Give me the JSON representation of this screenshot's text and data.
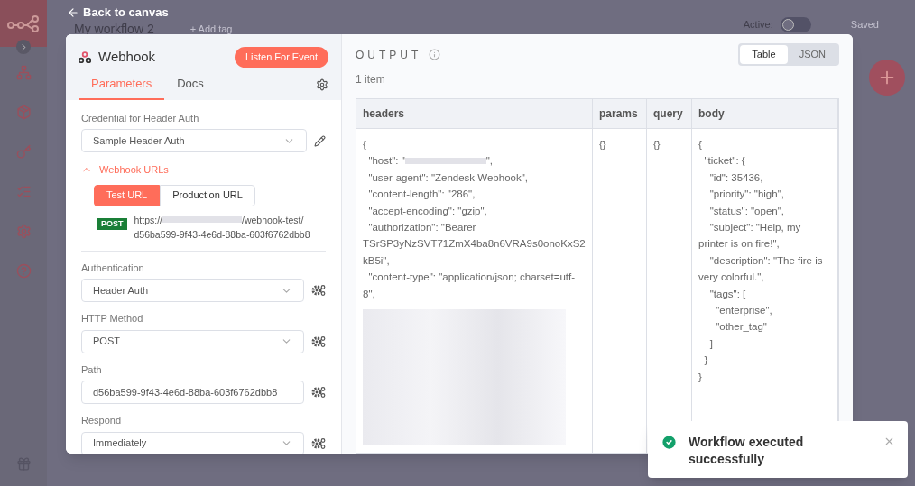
{
  "header": {
    "back_label": "Back to canvas",
    "workflow_name": "My workflow 2",
    "add_tag": "+ Add tag",
    "active_label": "Active:",
    "active": false,
    "saved": "Saved"
  },
  "node": {
    "title": "Webhook",
    "listen_button": "Listen For Event",
    "tabs": [
      {
        "label": "Parameters",
        "selected": true
      },
      {
        "label": "Docs",
        "selected": false
      }
    ],
    "credential": {
      "label": "Credential for Header Auth",
      "value": "Sample Header Auth"
    },
    "webhook_urls": {
      "label": "Webhook URLs",
      "expanded": true,
      "url_tabs": [
        {
          "label": "Test URL",
          "selected": true
        },
        {
          "label": "Production URL",
          "selected": false
        }
      ],
      "method": "POST",
      "url_start": "https://",
      "url_end": "/webhook-test/",
      "url_path": "d56ba599-9f43-4e6d-88ba-603f6762dbb8"
    },
    "fields": [
      {
        "label": "Authentication",
        "value": "Header Auth",
        "kind": "select"
      },
      {
        "label": "HTTP Method",
        "value": "POST",
        "kind": "select"
      },
      {
        "label": "Path",
        "value": "d56ba599-9f43-4e6d-88ba-603f6762dbb8",
        "kind": "input"
      },
      {
        "label": "Respond",
        "value": "Immediately",
        "kind": "select"
      }
    ]
  },
  "output": {
    "title": "OUTPUT",
    "count": "1 item",
    "view_tabs": [
      {
        "label": "Table",
        "selected": true
      },
      {
        "label": "JSON",
        "selected": false
      }
    ],
    "table": {
      "columns": [
        "headers",
        "params",
        "query",
        "body"
      ],
      "cells": [
        [
          {
            "kind": "text",
            "text": "{"
          },
          {
            "kind": "redacted",
            "before": "  \"host\": \"",
            "after": "\","
          },
          {
            "kind": "text",
            "text": "  \"user-agent\": \"Zendesk Webhook\","
          },
          {
            "kind": "text",
            "text": "  \"content-length\": \"286\","
          },
          {
            "kind": "text",
            "text": "  \"accept-encoding\": \"gzip\","
          },
          {
            "kind": "text",
            "text": "  \"authorization\": \"Bearer TSrSP3yNzSVT71ZmX4ba8n6VRA9s0onoKxS2kB5i\","
          },
          {
            "kind": "text",
            "text": "  \"content-type\": \"application/json; charset=utf-8\","
          },
          {
            "kind": "blur"
          }
        ],
        [
          {
            "kind": "text",
            "text": "{}"
          }
        ],
        [
          {
            "kind": "text",
            "text": "{}"
          }
        ],
        [
          {
            "kind": "text",
            "text": "{"
          },
          {
            "kind": "text",
            "text": "  \"ticket\": {"
          },
          {
            "kind": "text",
            "text": "    \"id\": 35436,"
          },
          {
            "kind": "text",
            "text": "    \"priority\": \"high\","
          },
          {
            "kind": "text",
            "text": "    \"status\": \"open\","
          },
          {
            "kind": "text",
            "text": "    \"subject\": \"Help, my printer is on fire!\","
          },
          {
            "kind": "text",
            "text": "    \"description\": \"The fire is very colorful.\","
          },
          {
            "kind": "text",
            "text": "    \"tags\": ["
          },
          {
            "kind": "text",
            "text": "      \"enterprise\","
          },
          {
            "kind": "text",
            "text": "      \"other_tag\""
          },
          {
            "kind": "text",
            "text": "    ]"
          },
          {
            "kind": "text",
            "text": "  }"
          },
          {
            "kind": "text",
            "text": "}"
          }
        ]
      ]
    }
  },
  "toast": {
    "message": "Workflow executed successfully"
  }
}
